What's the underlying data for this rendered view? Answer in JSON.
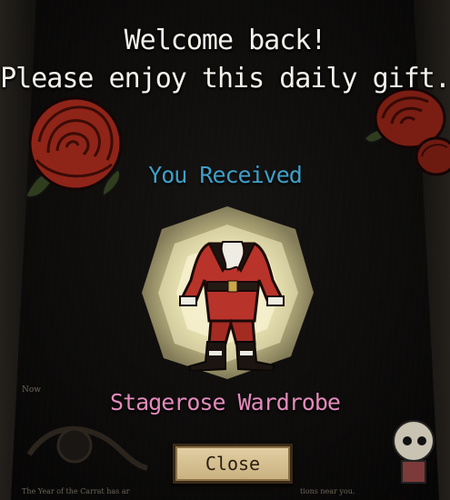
{
  "dialog": {
    "title_line1": "Welcome back!",
    "title_line2": "Please enjoy this daily gift.",
    "received_label": "You Received",
    "item_name": "Stagerose Wardrobe",
    "close_label": "Close"
  },
  "background": {
    "side_text": "Now",
    "footer_left": "The Year of the Carrat has ar",
    "footer_right": "tions near you."
  },
  "colors": {
    "title": "#f4f1ea",
    "received": "#3ea0c9",
    "item_name": "#e38bbb",
    "button": "#d6c090",
    "rose": "#a0281c"
  },
  "icons": [
    "rose-left-icon",
    "rose-right-icon",
    "rose-right-small-icon",
    "wardrobe-costume-icon",
    "gift-glow-icon"
  ]
}
